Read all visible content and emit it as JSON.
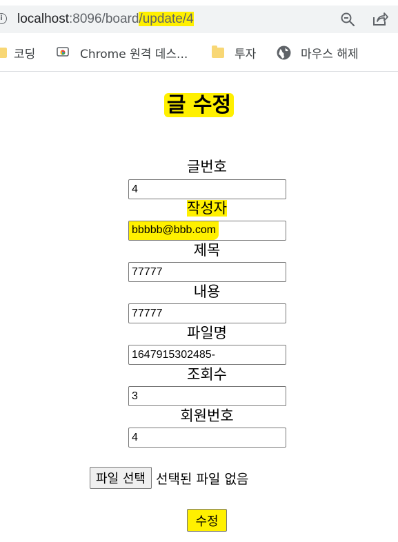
{
  "browser": {
    "url_host": "localhost",
    "url_port_path": ":8096/board",
    "url_highlight": "/update/4",
    "bookmarks": [
      {
        "label": "코딩",
        "icon": "folder-icon"
      },
      {
        "label": "Chrome 원격 데스...",
        "icon": "chrome-remote-desktop-icon"
      },
      {
        "label": "투자",
        "icon": "folder-icon"
      },
      {
        "label": "마우스 해제",
        "icon": "globe-icon"
      }
    ]
  },
  "form": {
    "title": "글 수정",
    "fields": [
      {
        "label": "글번호",
        "value": "4"
      },
      {
        "label": "작성자",
        "value": "bbbbb@bbb.com"
      },
      {
        "label": "제목",
        "value": "77777"
      },
      {
        "label": "내용",
        "value": "77777"
      },
      {
        "label": "파일명",
        "value": "1647915302485-"
      },
      {
        "label": "조회수",
        "value": "3"
      },
      {
        "label": "회원번호",
        "value": "4"
      }
    ],
    "file_button": "파일 선택",
    "file_status": "선택된 파일 없음",
    "submit": "수정"
  },
  "colors": {
    "highlight": "#fff000",
    "addressbar": "#f1f3f4"
  }
}
